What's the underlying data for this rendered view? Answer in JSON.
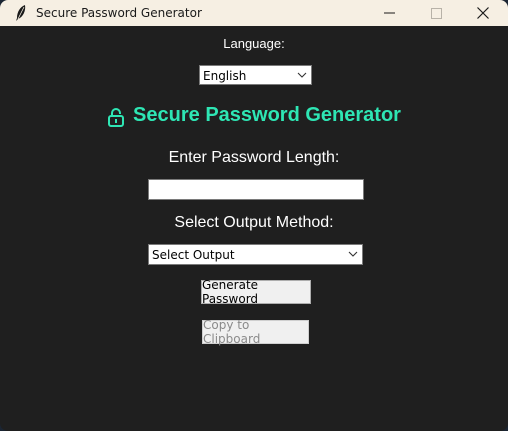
{
  "window": {
    "title": "Secure Password Generator"
  },
  "language": {
    "label": "Language:",
    "selected": "English"
  },
  "heading": {
    "text": "Secure Password Generator",
    "icon": "lock-icon",
    "color": "#2ee6b4"
  },
  "length": {
    "label": "Enter Password Length:",
    "value": ""
  },
  "output": {
    "label": "Select Output Method:",
    "selected": "Select Output"
  },
  "buttons": {
    "generate": "Generate Password",
    "copy": "Copy to Clipboard"
  }
}
